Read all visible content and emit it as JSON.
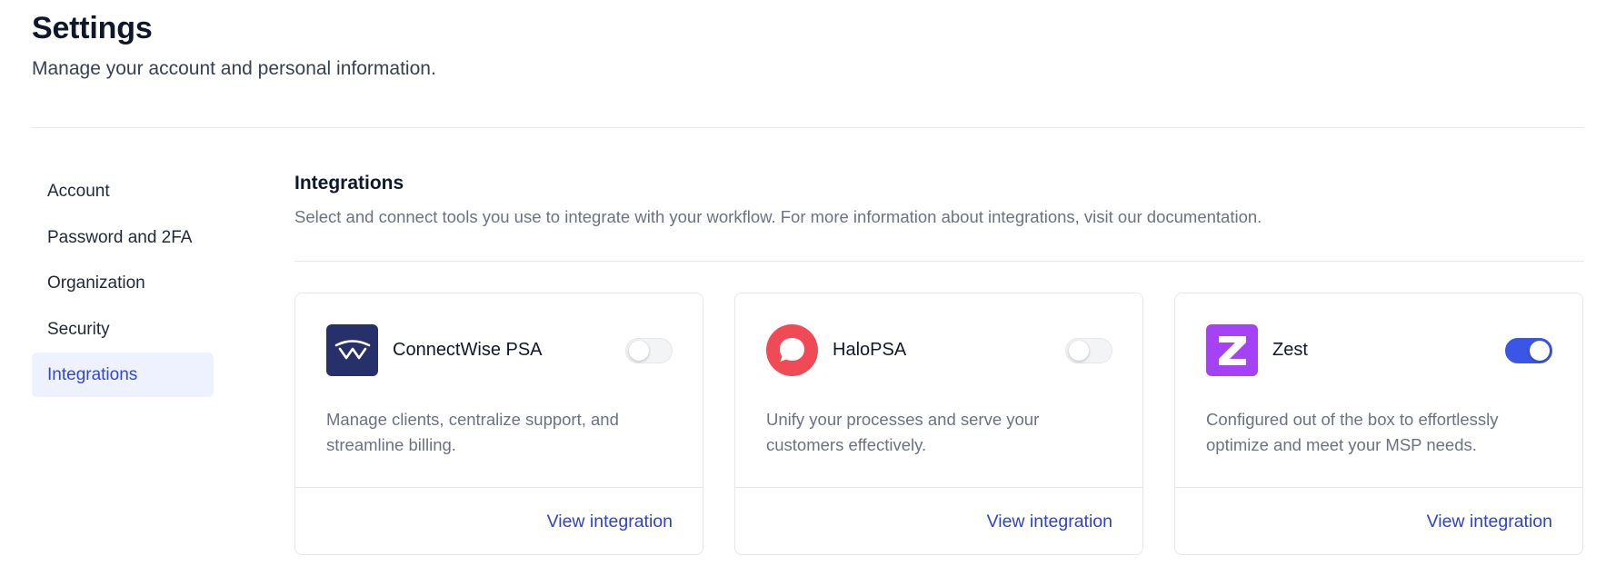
{
  "header": {
    "title": "Settings",
    "subtitle": "Manage your account and personal information."
  },
  "sidebar": {
    "items": [
      {
        "label": "Account",
        "active": false
      },
      {
        "label": "Password and 2FA",
        "active": false
      },
      {
        "label": "Organization",
        "active": false
      },
      {
        "label": "Security",
        "active": false
      },
      {
        "label": "Integrations",
        "active": true
      }
    ]
  },
  "section": {
    "title": "Integrations",
    "description": "Select and connect tools you use to integrate with your workflow. For more information about integrations, visit our documentation."
  },
  "integrations": [
    {
      "name": "ConnectWise PSA",
      "description": "Manage clients, centralize support, and streamline billing.",
      "enabled": false,
      "link_label": "View integration",
      "logo_color": "#26306b",
      "icon": "connectwise-logo-icon"
    },
    {
      "name": "HaloPSA",
      "description": "Unify your processes and serve your customers effectively.",
      "enabled": false,
      "link_label": "View integration",
      "logo_color": "#f04a56",
      "icon": "halopsa-logo-icon"
    },
    {
      "name": "Zest",
      "description": "Configured out of the box to effortlessly optimize and meet your MSP needs.",
      "enabled": true,
      "link_label": "View integration",
      "logo_color": "#a542f5",
      "icon": "zest-logo-icon"
    }
  ],
  "colors": {
    "accent": "#3b55e6",
    "link": "#2e42d0",
    "active_nav_bg": "#eef2ff"
  }
}
